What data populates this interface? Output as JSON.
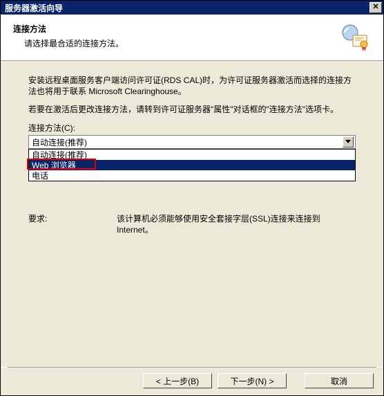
{
  "window": {
    "title": "服务器激活向导"
  },
  "header": {
    "heading": "连接方法",
    "sub": "请选择最合适的连接方法。"
  },
  "content": {
    "para1": "安装远程桌面服务客户端访问许可证(RDS CAL)时，为许可证服务器激活而选择的连接方法也将用于联系 Microsoft Clearinghouse。",
    "para2": "若要在激活后更改连接方法，请转到许可证服务器\"属性\"对话框的\"连接方法\"选项卡。",
    "combo_label": "连接方法(C):",
    "combo_value": "自动连接(推荐)",
    "options": [
      "自动连接(推荐)",
      "Web 浏览器",
      "电话"
    ],
    "selected_index": 1,
    "requirements_label": "要求:",
    "requirements_text": "该计算机必须能够使用安全套接字层(SSL)连接来连接到 Internet。"
  },
  "buttons": {
    "back": "< 上一步(B)",
    "next": "下一步(N) >",
    "cancel": "取消"
  },
  "icons": {
    "close": "close-icon",
    "cert": "certificate-icon",
    "arrow": "chevron-down-icon"
  }
}
